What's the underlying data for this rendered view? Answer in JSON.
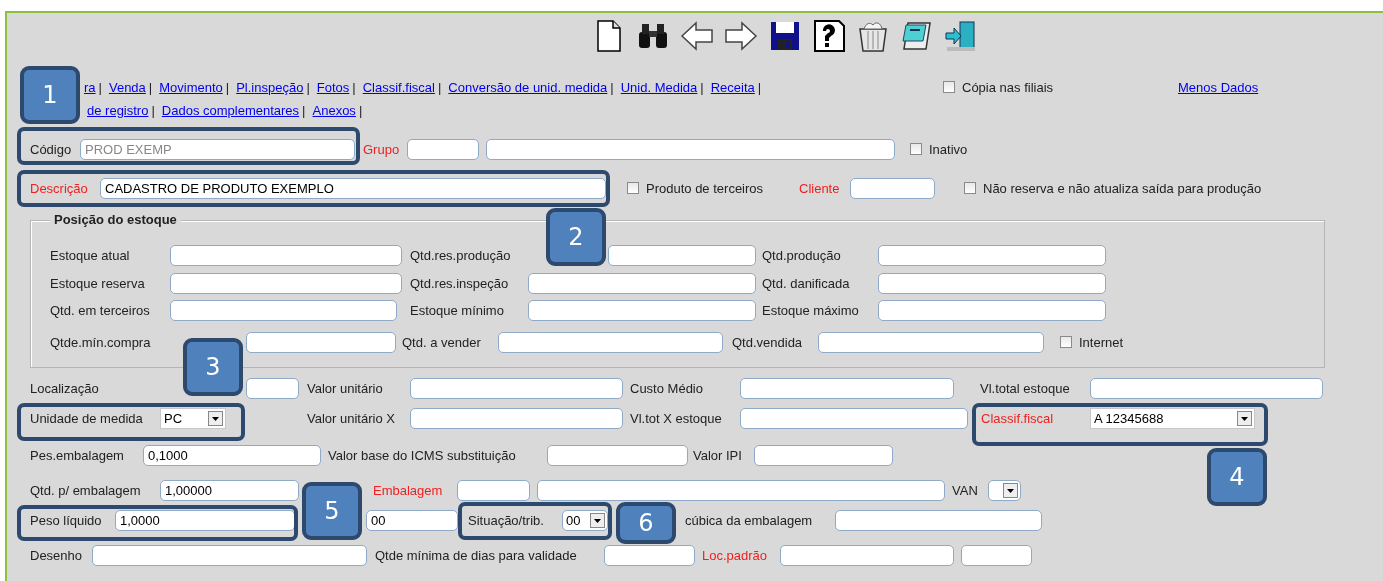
{
  "links": [
    [
      {
        "text": "ra",
        "separator": "|"
      },
      {
        "text": "Venda",
        "separator": "|"
      },
      {
        "text": "Movimento",
        "separator": "|"
      },
      {
        "text": "Pl.inspeção",
        "separator": "|"
      },
      {
        "text": "Fotos",
        "separator": "|"
      },
      {
        "text": "Classif.fiscal",
        "separator": "|"
      },
      {
        "text": "Conversão de unid. medida",
        "separator": "|"
      },
      {
        "text": "Unid. Medida",
        "separator": "|"
      },
      {
        "text": "Receita",
        "separator": "|"
      }
    ],
    [
      {
        "text": "de registro",
        "separator": "|"
      },
      {
        "text": "Dados complementares",
        "separator": "|"
      },
      {
        "text": "Anexos",
        "separator": "|"
      }
    ]
  ],
  "copy_to_branches": {
    "label": "Cópia nas filiais",
    "checked": false
  },
  "less_data_link": "Menos Dados",
  "top_rows": [
    [
      {
        "kind": "label",
        "text": "Código",
        "required": false
      },
      {
        "kind": "field",
        "value": "PROD EXEMP",
        "disabled": true
      },
      {
        "kind": "label",
        "text": "Grupo",
        "required": true
      },
      {
        "kind": "field"
      },
      {
        "kind": "field"
      },
      {
        "kind": "checkbox",
        "label": "Inativo",
        "checked": false
      }
    ],
    [
      {
        "kind": "label",
        "text": "Descrição",
        "required": true
      },
      {
        "kind": "field",
        "value": "CADASTRO DE PRODUTO EXEMPLO",
        "disabled": false
      },
      {
        "kind": "checkbox",
        "label": "Produto de terceiros",
        "checked": false
      },
      {
        "kind": "label",
        "text": "Cliente",
        "required": true
      },
      {
        "kind": "field"
      },
      {
        "kind": "checkbox",
        "label": "Não reserva e não atualiza saída para produção",
        "checked": false
      }
    ]
  ],
  "stock_position": {
    "legend": "Posição do estoque",
    "rows": [
      [
        {
          "kind": "label",
          "text": "Estoque atual",
          "required": false
        },
        {
          "kind": "field"
        },
        {
          "kind": "label",
          "text": "Qtd.res.produção",
          "required": false
        },
        {
          "kind": "field"
        },
        {
          "kind": "label",
          "text": "Qtd.produção",
          "required": false
        },
        {
          "kind": "field"
        }
      ],
      [
        {
          "kind": "label",
          "text": "Estoque reserva",
          "required": false
        },
        {
          "kind": "field"
        },
        {
          "kind": "label",
          "text": "Qtd.res.inspeção",
          "required": false
        },
        {
          "kind": "field"
        },
        {
          "kind": "label",
          "text": "Qtd. danificada",
          "required": false
        },
        {
          "kind": "field"
        }
      ],
      [
        {
          "kind": "label",
          "text": "Qtd. em terceiros",
          "required": false
        },
        {
          "kind": "field"
        },
        {
          "kind": "label",
          "text": "Estoque mínimo",
          "required": false
        },
        {
          "kind": "field"
        },
        {
          "kind": "label",
          "text": "Estoque máximo",
          "required": false
        },
        {
          "kind": "field"
        }
      ],
      [
        {
          "kind": "label",
          "text": "Qtde.mín.compra",
          "required": false
        },
        {
          "kind": "field"
        },
        {
          "kind": "label",
          "text": "Qtd. a vender",
          "required": false
        },
        {
          "kind": "field"
        },
        {
          "kind": "label",
          "text": "Qtd.vendida",
          "required": false
        },
        {
          "kind": "field"
        },
        {
          "kind": "checkbox",
          "label": "Internet",
          "checked": false
        }
      ]
    ]
  },
  "bottom_rows": [
    [
      {
        "kind": "label",
        "text": "Localização",
        "required": false
      },
      {
        "kind": "field"
      },
      {
        "kind": "label",
        "text": "Valor unitário",
        "required": false
      },
      {
        "kind": "field"
      },
      {
        "kind": "label",
        "text": "Custo Médio",
        "required": false
      },
      {
        "kind": "field"
      },
      {
        "kind": "label",
        "text": "Vl.total estoque",
        "required": false
      },
      {
        "kind": "field"
      }
    ],
    [
      {
        "kind": "label",
        "text": "Unidade de medida",
        "required": false
      },
      {
        "kind": "select",
        "value": "PC"
      },
      {
        "kind": "label",
        "text": "Valor unitário X",
        "required": false
      },
      {
        "kind": "field"
      },
      {
        "kind": "label",
        "text": "Vl.tot X estoque",
        "required": false
      },
      {
        "kind": "field"
      },
      {
        "kind": "label",
        "text": "Classif.fiscal",
        "required": true
      },
      {
        "kind": "select",
        "value": "A 12345688"
      }
    ],
    [
      {
        "kind": "label",
        "text": "Pes.embalagem",
        "required": false
      },
      {
        "kind": "field",
        "value": "0,1000"
      },
      {
        "kind": "label",
        "text": "Valor base do ICMS substituição",
        "required": false
      },
      {
        "kind": "field"
      },
      {
        "kind": "label",
        "text": "Valor IPI",
        "required": false
      },
      {
        "kind": "field"
      }
    ],
    [
      {
        "kind": "label",
        "text": "Qtd. p/ embalagem",
        "required": false
      },
      {
        "kind": "field",
        "value": "1,00000"
      },
      {
        "kind": "label",
        "text": "Embalagem",
        "required": true
      },
      {
        "kind": "field"
      },
      {
        "kind": "field"
      },
      {
        "kind": "label",
        "text": "VAN",
        "required": false
      },
      {
        "kind": "select"
      }
    ],
    [
      {
        "kind": "label",
        "text": "Peso líquido",
        "required": false
      },
      {
        "kind": "field",
        "value": "1,0000"
      },
      {
        "kind": "field",
        "value": "00"
      },
      {
        "kind": "label",
        "text": "Situação/trib.",
        "required": false
      },
      {
        "kind": "select",
        "value": "00"
      },
      {
        "kind": "label",
        "text": "cúbica da embalagem",
        "required": false
      },
      {
        "kind": "field"
      }
    ],
    [
      {
        "kind": "label",
        "text": "Desenho",
        "required": false
      },
      {
        "kind": "field"
      },
      {
        "kind": "label",
        "text": "Qtde mínima de dias para validade",
        "required": false
      },
      {
        "kind": "field"
      },
      {
        "kind": "label",
        "text": "Loc.padrão",
        "required": true
      },
      {
        "kind": "field"
      },
      {
        "kind": "field"
      }
    ]
  ],
  "callouts": [
    {
      "number": "1"
    },
    {
      "number": "2"
    },
    {
      "number": "3"
    },
    {
      "number": "4"
    },
    {
      "number": "5"
    },
    {
      "number": "6"
    }
  ]
}
